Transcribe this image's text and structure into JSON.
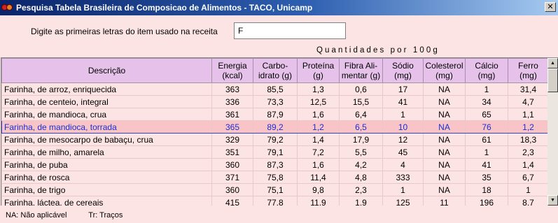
{
  "window": {
    "title": "Pesquisa Tabela Brasileira de Composicao de Alimentos - TACO, Unicamp",
    "close_label": "✕"
  },
  "search": {
    "label": "Digite as primeiras letras do item usado na receita",
    "value": "F"
  },
  "quantities_label": "Quantidades por 100g",
  "table": {
    "headers": [
      "Descrição",
      "Energia (kcal)",
      "Carbo- idrato (g)",
      "Proteína (g)",
      "Fibra Ali- mentar (g)",
      "Sódio (mg)",
      "Colesterol (mg)",
      "Cálcio (mg)",
      "Ferro (mg)"
    ],
    "selected_row": 3,
    "rows": [
      [
        "Farinha, de arroz, enriquecida",
        "363",
        "85,5",
        "1,3",
        "0,6",
        "17",
        "NA",
        "1",
        "31,4"
      ],
      [
        "Farinha, de centeio, integral",
        "336",
        "73,3",
        "12,5",
        "15,5",
        "41",
        "NA",
        "34",
        "4,7"
      ],
      [
        "Farinha, de mandioca, crua",
        "361",
        "87,9",
        "1,6",
        "6,4",
        "1",
        "NA",
        "65",
        "1,1"
      ],
      [
        "Farinha, de mandioca, torrada",
        "365",
        "89,2",
        "1,2",
        "6,5",
        "10",
        "NA",
        "76",
        "1,2"
      ],
      [
        "Farinha, de mesocarpo de babaçu, crua",
        "329",
        "79,2",
        "1,4",
        "17,9",
        "12",
        "NA",
        "61",
        "18,3"
      ],
      [
        "Farinha, de milho, amarela",
        "351",
        "79,1",
        "7,2",
        "5,5",
        "45",
        "NA",
        "1",
        "2,3"
      ],
      [
        "Farinha, de puba",
        "360",
        "87,3",
        "1,6",
        "4,2",
        "4",
        "NA",
        "41",
        "1,4"
      ],
      [
        "Farinha, de rosca",
        "371",
        "75,8",
        "11,4",
        "4,8",
        "333",
        "NA",
        "35",
        "6,7"
      ],
      [
        "Farinha, de trigo",
        "360",
        "75,1",
        "9,8",
        "2,3",
        "1",
        "NA",
        "18",
        "1"
      ],
      [
        "Farinha, láctea, de cereais",
        "415",
        "77,8",
        "11,9",
        "1,9",
        "125",
        "11",
        "196",
        "8,7"
      ]
    ]
  },
  "footer": {
    "na_note": "NA: Não aplicável",
    "tr_note": "Tr: Traços"
  },
  "icons": [
    "app-icon",
    "close-icon",
    "scroll-up-icon",
    "scroll-down-icon"
  ]
}
